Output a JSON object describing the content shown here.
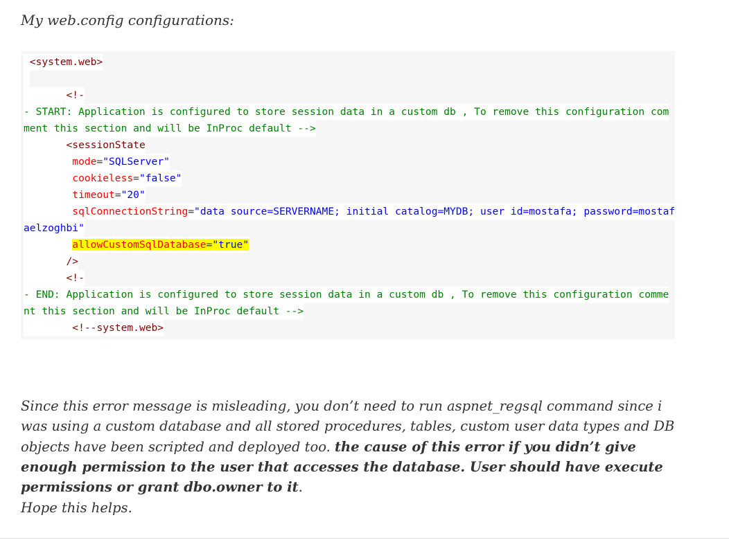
{
  "intro": "My web.config configurations:",
  "code": {
    "lines": [
      {
        "indent": "",
        "parts": [
          {
            "t": " ",
            "c": ""
          },
          {
            "t": "<system.web>",
            "c": "tag"
          }
        ]
      },
      {
        "indent": "",
        "parts": [
          {
            "t": " ",
            "c": ""
          }
        ]
      },
      {
        "indent": "",
        "parts": [
          {
            "t": "       ",
            "c": ""
          },
          {
            "t": "<!-",
            "c": "tag"
          }
        ]
      },
      {
        "indent": "",
        "parts": [
          {
            "t": "- START: Application is configured to store session data in a custom db , To remove this configuration com",
            "c": "cmt"
          }
        ]
      },
      {
        "indent": "",
        "parts": [
          {
            "t": "ment this section and will be InProc default -->",
            "c": "cmt"
          }
        ]
      },
      {
        "indent": "",
        "parts": [
          {
            "t": "       ",
            "c": ""
          },
          {
            "t": "<sessionState",
            "c": "tag"
          }
        ]
      },
      {
        "indent": "",
        "parts": [
          {
            "t": "        ",
            "c": ""
          },
          {
            "t": "mode",
            "c": "attr"
          },
          {
            "t": "=",
            "c": ""
          },
          {
            "t": "\"SQLServer\"",
            "c": "val"
          }
        ]
      },
      {
        "indent": "",
        "parts": [
          {
            "t": "        ",
            "c": ""
          },
          {
            "t": "cookieless",
            "c": "attr"
          },
          {
            "t": "=",
            "c": ""
          },
          {
            "t": "\"false\"",
            "c": "val"
          }
        ]
      },
      {
        "indent": "",
        "parts": [
          {
            "t": "        ",
            "c": ""
          },
          {
            "t": "timeout",
            "c": "attr"
          },
          {
            "t": "=",
            "c": ""
          },
          {
            "t": "\"20\"",
            "c": "val"
          }
        ]
      },
      {
        "indent": "",
        "parts": [
          {
            "t": "        ",
            "c": ""
          },
          {
            "t": "sqlConnectionString",
            "c": "attr"
          },
          {
            "t": "=",
            "c": ""
          },
          {
            "t": "\"data source=SERVERNAME; initial catalog=MYDB; user id=mostafa; password=mostaf",
            "c": "val"
          }
        ]
      },
      {
        "indent": "",
        "parts": [
          {
            "t": "aelzoghbi\"",
            "c": "val"
          }
        ]
      },
      {
        "indent": "",
        "parts": [
          {
            "t": "        ",
            "c": ""
          },
          {
            "t": "allowCustomSqlDatabase",
            "c": "attr mark"
          },
          {
            "t": "=",
            "c": "mark"
          },
          {
            "t": "\"true\"",
            "c": "val mark"
          }
        ]
      },
      {
        "indent": "",
        "parts": [
          {
            "t": "       ",
            "c": ""
          },
          {
            "t": "/>",
            "c": "tag"
          }
        ]
      },
      {
        "indent": "",
        "parts": [
          {
            "t": "       ",
            "c": ""
          },
          {
            "t": "<!-",
            "c": "tag"
          }
        ]
      },
      {
        "indent": "",
        "parts": [
          {
            "t": "- END: Application is configured to store session data in a custom db , To remove this configuration comme",
            "c": "cmt"
          }
        ]
      },
      {
        "indent": "",
        "parts": [
          {
            "t": "nt this section and will be InProc default -->",
            "c": "cmt"
          }
        ]
      },
      {
        "indent": "",
        "parts": [
          {
            "t": "        ",
            "c": ""
          },
          {
            "t": "<!--system.web>",
            "c": "tag"
          }
        ]
      }
    ]
  },
  "paragraph": {
    "normal": "Since this error message is misleading, you don’t need to run aspnet_regsql command since i was using a custom database and all stored procedures, tables, custom user data types and DB objects have been scripted and deployed too. ",
    "bold": "the cause of this error if you didn’t give enough permission to the user that accesses the database. User should have execute permissions or grant dbo.owner to it",
    "end": "."
  },
  "closing": "Hope this helps."
}
